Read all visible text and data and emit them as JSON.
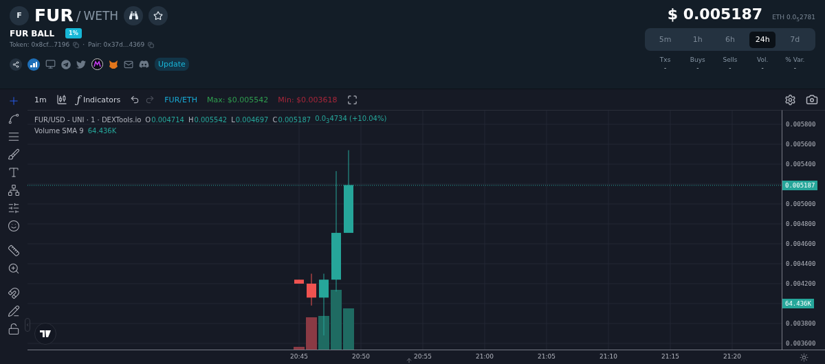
{
  "pair": {
    "avatar": "F",
    "base": "FUR",
    "separator": "/",
    "quote": "WETH"
  },
  "token": {
    "name": "FUR BALL",
    "tax_badge": "1%",
    "token_label": "Token: 0x8cf...7196",
    "dot": "·",
    "pair_label": "Pair: 0x37d...4369"
  },
  "update_button": "Update",
  "price": {
    "usd": "$ 0.005187",
    "eth": "ETH 0.0$_{5}$2781"
  },
  "periods": [
    {
      "label": "5m",
      "selected": false
    },
    {
      "label": "1h",
      "selected": false
    },
    {
      "label": "6h",
      "selected": false
    },
    {
      "label": "24h",
      "selected": true
    },
    {
      "label": "7d",
      "selected": false
    }
  ],
  "stats": [
    {
      "label": "Txs",
      "value": "-"
    },
    {
      "label": "Buys",
      "value": "-"
    },
    {
      "label": "Sells",
      "value": "-"
    },
    {
      "label": "Vol.",
      "value": "-"
    },
    {
      "label": "% Var.",
      "value": "-"
    }
  ],
  "chart_toolbar": {
    "interval": "1m",
    "function_glyph": "ƒ",
    "indicators": "Indicators",
    "undo": {
      "disabled": false
    },
    "redo": {
      "disabled": true
    },
    "pair": "FUR/ETH",
    "max": "Max: $0.005542",
    "min": "Min: $0.003618"
  },
  "tools": [
    {
      "kind": "crosshair",
      "selected": true
    },
    {
      "kind": "trendline",
      "selected": false
    },
    {
      "kind": "lines",
      "selected": false
    },
    {
      "kind": "brush",
      "selected": false
    },
    {
      "kind": "text",
      "selected": false
    },
    {
      "kind": "pattern",
      "selected": false
    },
    {
      "kind": "fib",
      "selected": false
    },
    {
      "kind": "emoji",
      "selected": false
    },
    {
      "kind": "ruler",
      "selected": false
    },
    {
      "kind": "zoom",
      "selected": false
    },
    {
      "kind": "magnet",
      "selected": false
    },
    {
      "kind": "drawlock",
      "selected": false
    },
    {
      "kind": "lock",
      "selected": false
    }
  ],
  "legend": {
    "symbol": "FUR/USD - UNI · 1 · DEXTools.io",
    "ohlc": [
      {
        "key": "O",
        "value": "0.004714"
      },
      {
        "key": "H",
        "value": "0.005542"
      },
      {
        "key": "L",
        "value": "0.004697"
      },
      {
        "key": "C",
        "value": "0.005187"
      }
    ],
    "change": "0.0$_{3}$4734 (+10.04%)",
    "volume_label": "Volume SMA 9",
    "volume_value": "64.436K"
  },
  "price_axis": [
    "0.005800",
    "0.005600",
    "0.005400",
    "0.005000",
    "0.004800",
    "0.004600",
    "0.004400",
    "0.004200",
    "0.003800",
    "0.003600"
  ],
  "last_price": "0.005187",
  "volume_badge": "64.436K",
  "time_axis": [
    "20:45",
    "20:50",
    "20:55",
    "21:00",
    "21:05",
    "21:10",
    "21:15",
    "21:20"
  ]
}
